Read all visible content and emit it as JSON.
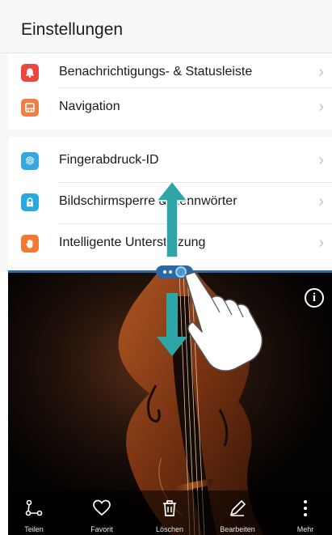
{
  "header": {
    "title": "Einstellungen"
  },
  "settings_items": [
    {
      "label": "Benachrichtigungs- & Statusleiste",
      "icon": "bell-icon",
      "color": "#e9473f"
    },
    {
      "label": "Navigation",
      "icon": "navigation-icon",
      "color": "#f07f45"
    },
    {
      "label": "Fingerabdruck-ID",
      "icon": "fingerprint-icon",
      "color": "#35a9df"
    },
    {
      "label": "Bildschirmsperre & Kennwörter",
      "icon": "lock-icon",
      "color": "#29a9df"
    },
    {
      "label": "Intelligente Unterstützung",
      "icon": "hand-icon",
      "color": "#f17a33"
    }
  ],
  "chevron": "›",
  "photo": {
    "info_glyph": "i"
  },
  "toolbar": [
    {
      "label": "Teilen",
      "icon": "share-icon"
    },
    {
      "label": "Favorit",
      "icon": "heart-icon"
    },
    {
      "label": "Löschen",
      "icon": "trash-icon"
    },
    {
      "label": "Bearbeiten",
      "icon": "edit-icon"
    },
    {
      "label": "Mehr",
      "icon": "more-icon"
    }
  ],
  "colors": {
    "accent": "#2a67a3",
    "gesture_arrow": "#2ea6a7"
  }
}
